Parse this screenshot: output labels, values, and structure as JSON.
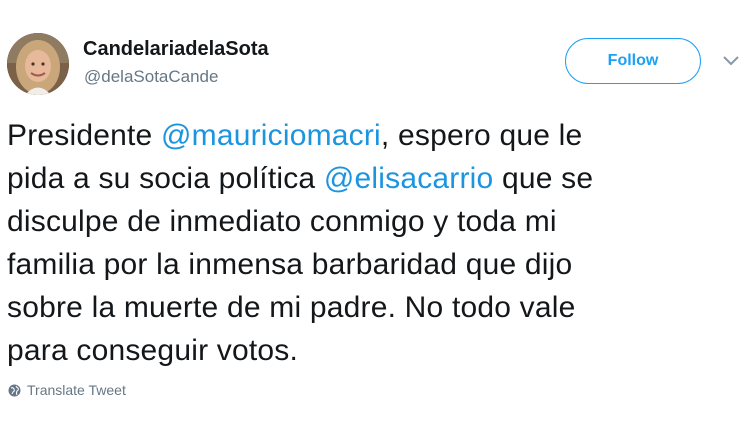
{
  "user": {
    "display_name": "CandelariadelaSota",
    "handle": "@delaSotaCande"
  },
  "follow_button": {
    "label": "Follow"
  },
  "tweet": {
    "lines": [
      [
        {
          "text": "Presidente ",
          "mention": false
        },
        {
          "text": "@mauriciomacri",
          "mention": true
        },
        {
          "text": ", espero que le",
          "mention": false
        }
      ],
      [
        {
          "text": "pida a su socia política ",
          "mention": false
        },
        {
          "text": "@elisacarrio",
          "mention": true
        },
        {
          "text": " que se",
          "mention": false
        }
      ],
      [
        {
          "text": "disculpe de inmediato conmigo y toda mi",
          "mention": false
        }
      ],
      [
        {
          "text": "familia por la inmensa barbaridad que dijo",
          "mention": false
        }
      ],
      [
        {
          "text": "sobre la muerte de mi padre. No todo vale",
          "mention": false
        }
      ],
      [
        {
          "text": "para conseguir votos.",
          "mention": false
        }
      ]
    ]
  },
  "translate": {
    "label": "Translate Tweet",
    "icon": "globe-icon"
  },
  "menu": {
    "icon": "chevron-down-icon"
  },
  "colors": {
    "link": "#1b95e0",
    "follow_blue": "#1da1f2",
    "secondary_text": "#657786",
    "primary_text": "#14171a"
  }
}
